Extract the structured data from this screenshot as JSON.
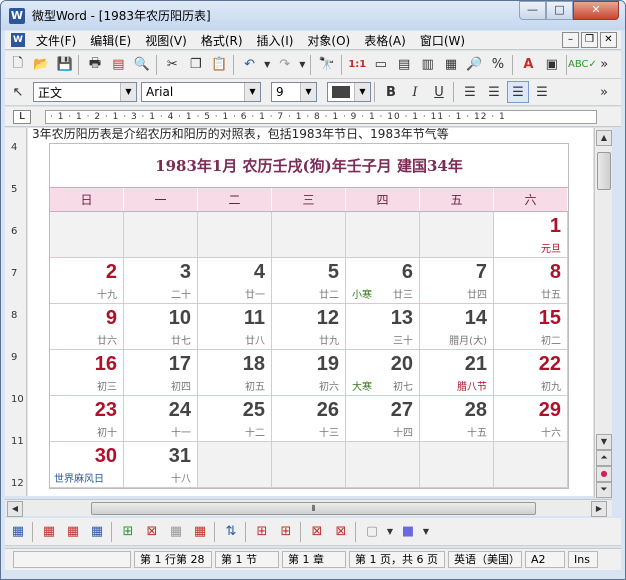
{
  "window": {
    "title": "微型Word - [1983年农历阳历表]",
    "app_icon": "W"
  },
  "menu": [
    "文件(F)",
    "编辑(E)",
    "视图(V)",
    "格式(R)",
    "插入(I)",
    "对象(O)",
    "表格(A)",
    "窗口(W)"
  ],
  "format": {
    "style": "正文",
    "font": "Arial",
    "size": "9"
  },
  "ruler": {
    "h_marks": "· 1 · 1 · 2 · 1 · 3 · 1 · 4 · 1 · 5 · 1 · 6 · 1 · 7 · 1 · 8 · 1 · 9 · 1 · 10 · 1 · 11 · 1 · 12 · 1",
    "v_numbers": [
      "4",
      "5",
      "6",
      "7",
      "8",
      "9",
      "10",
      "11",
      "12"
    ]
  },
  "document": {
    "intro_line": "3年农历阳历表是介绍农历和阳历的对照表，包括1983年节日、1983年节气等",
    "calendar": {
      "title": "1983年1月  农历壬戌(狗)年壬子月  建国34年",
      "weekdays": [
        "日",
        "一",
        "二",
        "三",
        "四",
        "五",
        "六"
      ],
      "weeks": [
        [
          null,
          null,
          null,
          null,
          null,
          null,
          {
            "d": "1",
            "l": "元旦",
            "red": true,
            "fest": true
          }
        ],
        [
          {
            "d": "2",
            "l": "十九",
            "red": true
          },
          {
            "d": "3",
            "l": "二十"
          },
          {
            "d": "4",
            "l": "廿一"
          },
          {
            "d": "5",
            "l": "廿二"
          },
          {
            "d": "6",
            "l": "廿三",
            "t": "小寒"
          },
          {
            "d": "7",
            "l": "廿四"
          },
          {
            "d": "8",
            "l": "廿五",
            "red": true
          }
        ],
        [
          {
            "d": "9",
            "l": "廿六",
            "red": true
          },
          {
            "d": "10",
            "l": "廿七"
          },
          {
            "d": "11",
            "l": "廿八"
          },
          {
            "d": "12",
            "l": "廿九"
          },
          {
            "d": "13",
            "l": "三十"
          },
          {
            "d": "14",
            "l": "腊月(大)"
          },
          {
            "d": "15",
            "l": "初二",
            "red": true
          }
        ],
        [
          {
            "d": "16",
            "l": "初三",
            "red": true
          },
          {
            "d": "17",
            "l": "初四"
          },
          {
            "d": "18",
            "l": "初五"
          },
          {
            "d": "19",
            "l": "初六"
          },
          {
            "d": "20",
            "l": "初七",
            "t": "大寒"
          },
          {
            "d": "21",
            "l": "腊八节",
            "fest": true
          },
          {
            "d": "22",
            "l": "初九",
            "red": true
          }
        ],
        [
          {
            "d": "23",
            "l": "初十",
            "red": true
          },
          {
            "d": "24",
            "l": "十一"
          },
          {
            "d": "25",
            "l": "十二"
          },
          {
            "d": "26",
            "l": "十三"
          },
          {
            "d": "27",
            "l": "十四"
          },
          {
            "d": "28",
            "l": "十五"
          },
          {
            "d": "29",
            "l": "十六",
            "red": true
          }
        ],
        [
          {
            "d": "30",
            "l": "世界麻风日",
            "red": true,
            "world": true
          },
          {
            "d": "31",
            "l": "十八"
          },
          null,
          null,
          null,
          null,
          null
        ]
      ]
    }
  },
  "status": {
    "pos": "第 1 行第 28",
    "section": "第 1 节",
    "chapter": "第 1 章",
    "page": "第 1 页，共 6 页",
    "lang": "英语（美国）",
    "cell": "A2",
    "mode": "Ins"
  }
}
